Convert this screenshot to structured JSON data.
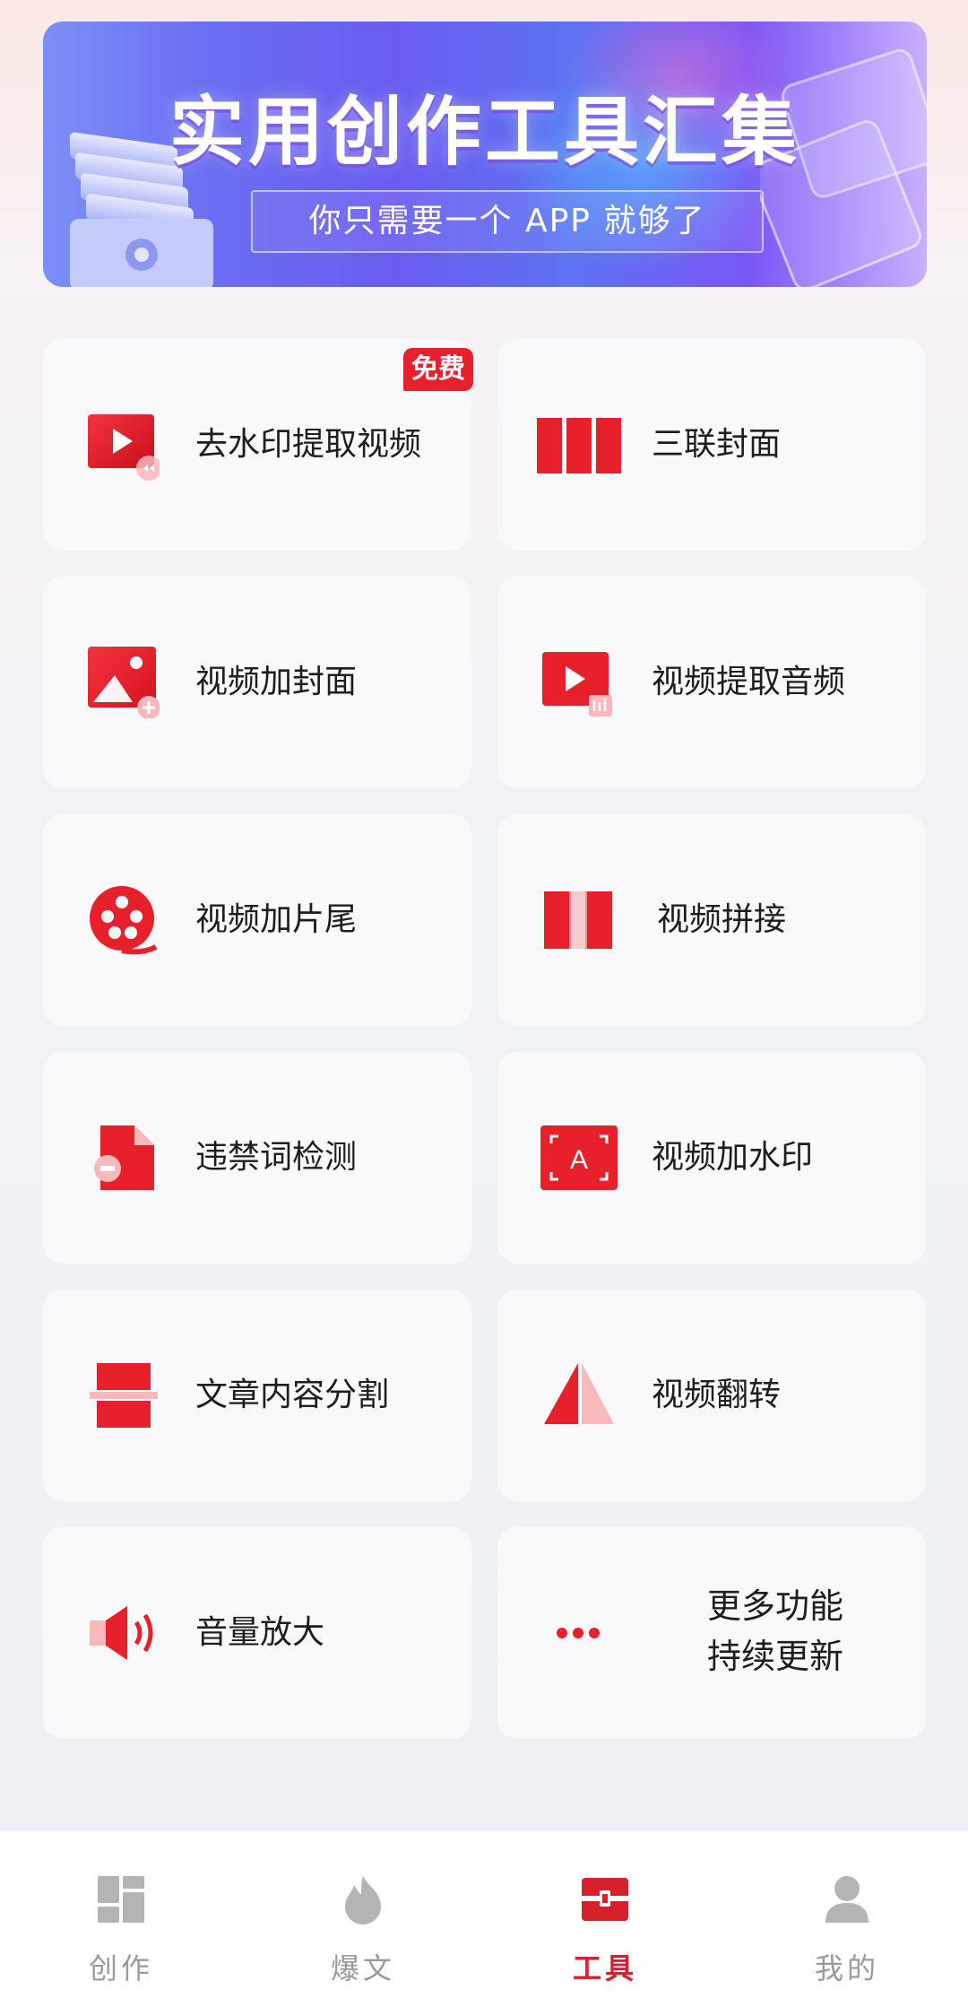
{
  "banner": {
    "title": "实用创作工具汇集",
    "subtitle": "你只需要一个 APP 就够了"
  },
  "tools": [
    {
      "label": "去水印提取视频",
      "icon": "video-play-icon",
      "badge": "免费"
    },
    {
      "label": "三联封面",
      "icon": "triple-cover-icon"
    },
    {
      "label": "视频加封面",
      "icon": "image-add-icon"
    },
    {
      "label": "视频提取音频",
      "icon": "video-audio-icon"
    },
    {
      "label": "视频加片尾",
      "icon": "film-reel-icon"
    },
    {
      "label": "视频拼接",
      "icon": "splice-icon"
    },
    {
      "label": "违禁词检测",
      "icon": "document-block-icon"
    },
    {
      "label": "视频加水印",
      "icon": "watermark-a-icon"
    },
    {
      "label": "文章内容分割",
      "icon": "split-icon"
    },
    {
      "label": "视频翻转",
      "icon": "flip-icon"
    },
    {
      "label": "音量放大",
      "icon": "speaker-icon"
    },
    {
      "label_line1": "更多功能",
      "label_line2": "持续更新",
      "icon": "more-dots-icon"
    }
  ],
  "nav": {
    "items": [
      {
        "label": "创作",
        "icon": "grid-icon",
        "active": false
      },
      {
        "label": "爆文",
        "icon": "flame-icon",
        "active": false
      },
      {
        "label": "工具",
        "icon": "toolbox-icon",
        "active": true
      },
      {
        "label": "我的",
        "icon": "user-icon",
        "active": false
      }
    ]
  },
  "colors": {
    "accent": "#e8202c",
    "nav_active": "#d8202c",
    "nav_inactive": "#9a9a9a",
    "card_bg": "#f9f9fb"
  }
}
